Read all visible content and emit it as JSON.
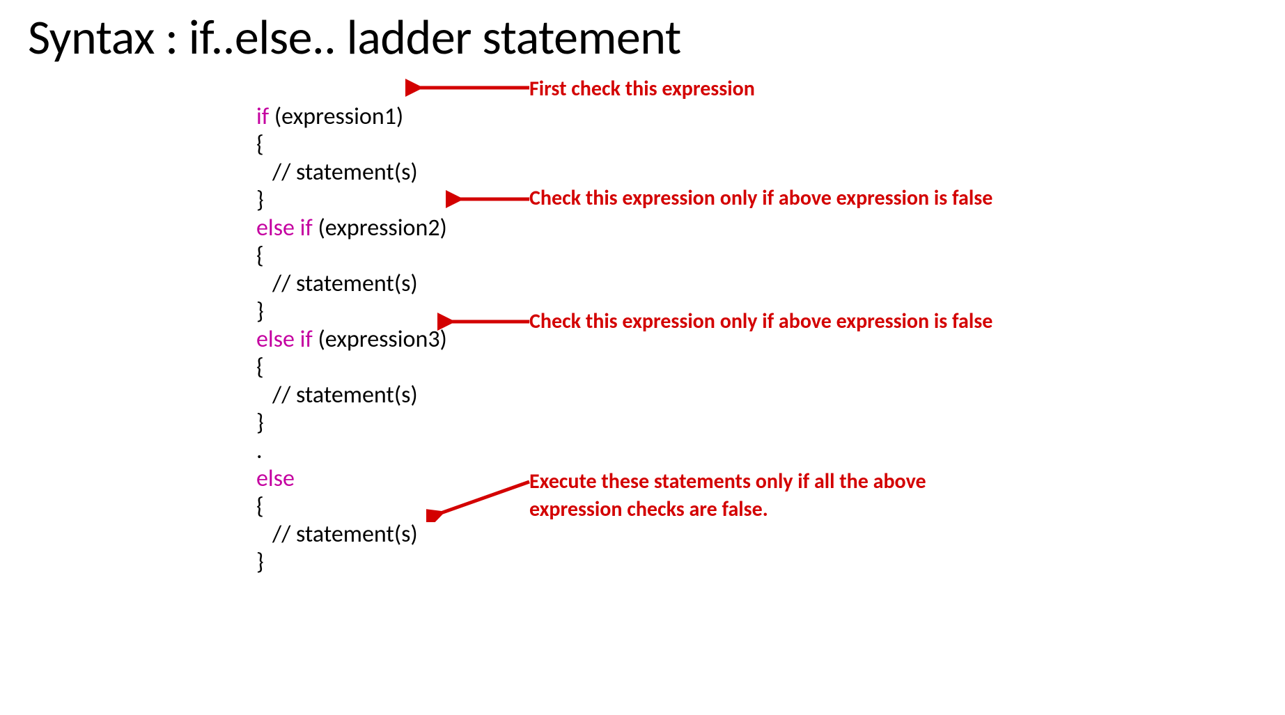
{
  "title": "Syntax : if..else.. ladder statement",
  "code": {
    "l1_kw": "if",
    "l1_rest": " (expression1)",
    "l2": "{",
    "l3": "   // statement(s)",
    "l4": "}",
    "l5_kw": "else if",
    "l5_rest": " (expression2)",
    "l6": "{",
    "l7": "   // statement(s)",
    "l8": "}",
    "l9_kw": "else if",
    "l9_rest": " (expression3)",
    "l10": "{",
    "l11": "   // statement(s)",
    "l12": "}",
    "l13": ".",
    "l14_kw": "else",
    "l15": "{",
    "l16": "   // statement(s)",
    "l17": "}"
  },
  "annotations": {
    "a1": "First check this expression",
    "a2": "Check this expression only if above expression is false",
    "a3": "Check this expression only if above expression is false",
    "a4": "Execute these statements only if all the above expression checks are false."
  },
  "arrow_color": "#d30000"
}
